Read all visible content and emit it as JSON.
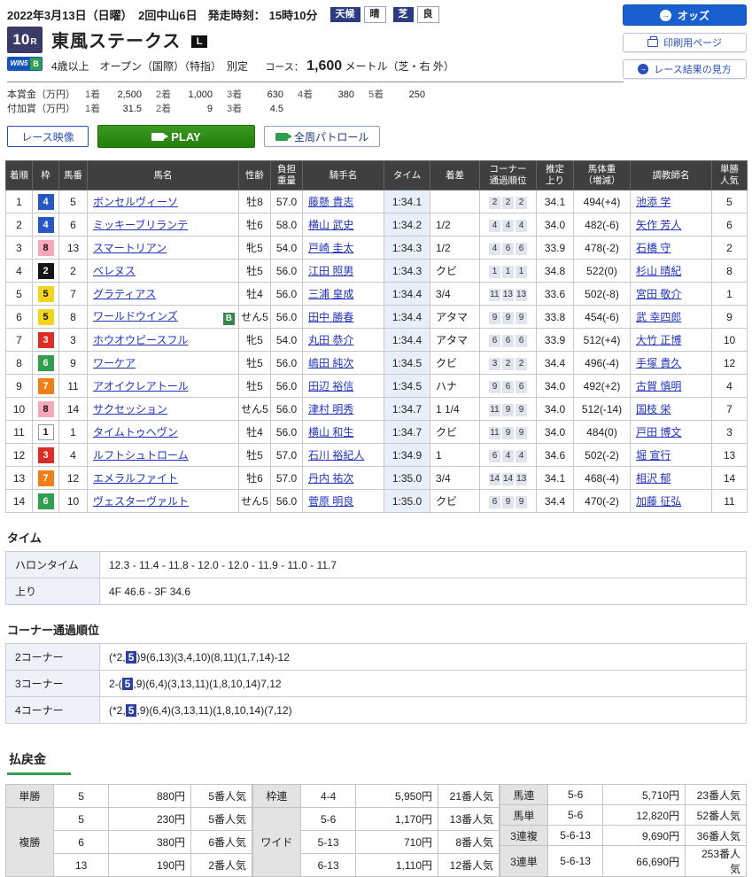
{
  "header": {
    "date_meet": "2022年3月13日（日曜）　2回中山6日",
    "start_label": "発走時刻：",
    "start_time": "15時10分",
    "weather": {
      "label": "天候",
      "value": "晴"
    },
    "turf": {
      "label": "芝",
      "value": "良"
    },
    "buttons": {
      "odds": "オッズ",
      "print": "印刷用ページ",
      "guide": "レース結果の見方"
    }
  },
  "icons": {
    "odds_arrow": "→",
    "guide_arrow": "→"
  },
  "race": {
    "number": "10",
    "r_suffix": "R",
    "win5": "WIN5",
    "win5_b": "B",
    "title": "東風ステークス",
    "grade": "L",
    "conditions": "4歳以上　オープン（国際）（特指）　別定",
    "course_label": "コース：",
    "distance": "1,600",
    "course_detail": "メートル（芝・右 外）",
    "prize_rows": [
      {
        "label": "本賞金（万円）",
        "pairs": [
          [
            "1着",
            "2,500"
          ],
          [
            "2着",
            "1,000"
          ],
          [
            "3着",
            "630"
          ],
          [
            "4着",
            "380"
          ],
          [
            "5着",
            "250"
          ]
        ]
      },
      {
        "label": "付加賞（万円）",
        "pairs": [
          [
            "1着",
            "31.5"
          ],
          [
            "2着",
            "9"
          ],
          [
            "3着",
            "4.5"
          ]
        ]
      }
    ]
  },
  "toolbar": {
    "race_video": "レース映像",
    "play": "PLAY",
    "patrol": "全周パトロール"
  },
  "results": {
    "headers": [
      [
        "着順"
      ],
      [
        "枠"
      ],
      [
        "馬番"
      ],
      [
        "馬名"
      ],
      [
        "性齢"
      ],
      [
        "負担",
        "重量"
      ],
      [
        "騎手名"
      ],
      [
        "タイム"
      ],
      [
        "着差"
      ],
      [
        "コーナー",
        "通過順位"
      ],
      [
        "推定",
        "上り"
      ],
      [
        "馬体重",
        "（増減）"
      ],
      [
        "調教師名"
      ],
      [
        "単勝",
        "人気"
      ]
    ],
    "rows": [
      {
        "pos": "1",
        "waku": "4",
        "wc": "w4",
        "num": "5",
        "horse": "ボンセルヴィーソ",
        "blinker": "",
        "sexage": "牡8",
        "load": "57.0",
        "jockey": "藤懸 貴志",
        "time": "1:34.1",
        "margin": "",
        "corners": [
          "2",
          "2",
          "2"
        ],
        "up": "34.1",
        "bw": "494(+4)",
        "trainer": "池添 学",
        "pop": "5"
      },
      {
        "pos": "2",
        "waku": "4",
        "wc": "w4",
        "num": "6",
        "horse": "ミッキーブリランテ",
        "blinker": "",
        "sexage": "牡6",
        "load": "58.0",
        "jockey": "横山 武史",
        "time": "1:34.2",
        "margin": "1/2",
        "corners": [
          "4",
          "4",
          "4"
        ],
        "up": "34.0",
        "bw": "482(-6)",
        "trainer": "矢作 芳人",
        "pop": "6"
      },
      {
        "pos": "3",
        "waku": "8",
        "wc": "w8",
        "num": "13",
        "horse": "スマートリアン",
        "blinker": "",
        "sexage": "牝5",
        "load": "54.0",
        "jockey": "戸崎 圭太",
        "time": "1:34.3",
        "margin": "1/2",
        "corners": [
          "4",
          "6",
          "6"
        ],
        "up": "33.9",
        "bw": "478(-2)",
        "trainer": "石橋 守",
        "pop": "2"
      },
      {
        "pos": "4",
        "waku": "2",
        "wc": "w2",
        "num": "2",
        "horse": "ベレヌス",
        "blinker": "",
        "sexage": "牡5",
        "load": "56.0",
        "jockey": "江田 照男",
        "time": "1:34.3",
        "margin": "クビ",
        "corners": [
          "1",
          "1",
          "1"
        ],
        "up": "34.8",
        "bw": "522(0)",
        "trainer": "杉山 晴紀",
        "pop": "8"
      },
      {
        "pos": "5",
        "waku": "5",
        "wc": "w5",
        "num": "7",
        "horse": "グラティアス",
        "blinker": "",
        "sexage": "牡4",
        "load": "56.0",
        "jockey": "三浦 皇成",
        "time": "1:34.4",
        "margin": "3/4",
        "corners": [
          "11",
          "13",
          "13"
        ],
        "up": "33.6",
        "bw": "502(-8)",
        "trainer": "宮田 敬介",
        "pop": "1"
      },
      {
        "pos": "6",
        "waku": "5",
        "wc": "w5",
        "num": "8",
        "horse": "ワールドウインズ",
        "blinker": "B",
        "sexage": "せん5",
        "load": "56.0",
        "jockey": "田中 勝春",
        "time": "1:34.4",
        "margin": "アタマ",
        "corners": [
          "9",
          "9",
          "9"
        ],
        "up": "33.8",
        "bw": "454(-6)",
        "trainer": "武 幸四郎",
        "pop": "9"
      },
      {
        "pos": "7",
        "waku": "3",
        "wc": "w3",
        "num": "3",
        "horse": "ホウオウピースフル",
        "blinker": "",
        "sexage": "牝5",
        "load": "54.0",
        "jockey": "丸田 恭介",
        "time": "1:34.4",
        "margin": "アタマ",
        "corners": [
          "6",
          "6",
          "6"
        ],
        "up": "33.9",
        "bw": "512(+4)",
        "trainer": "大竹 正博",
        "pop": "10"
      },
      {
        "pos": "8",
        "waku": "6",
        "wc": "w6",
        "num": "9",
        "horse": "ワーケア",
        "blinker": "",
        "sexage": "牡5",
        "load": "56.0",
        "jockey": "嶋田 純次",
        "time": "1:34.5",
        "margin": "クビ",
        "corners": [
          "3",
          "2",
          "2"
        ],
        "up": "34.4",
        "bw": "496(-4)",
        "trainer": "手塚 貴久",
        "pop": "12"
      },
      {
        "pos": "9",
        "waku": "7",
        "wc": "w7",
        "num": "11",
        "horse": "アオイクレアトール",
        "blinker": "",
        "sexage": "牡5",
        "load": "56.0",
        "jockey": "田辺 裕信",
        "time": "1:34.5",
        "margin": "ハナ",
        "corners": [
          "9",
          "6",
          "6"
        ],
        "up": "34.0",
        "bw": "492(+2)",
        "trainer": "古賀 慎明",
        "pop": "4"
      },
      {
        "pos": "10",
        "waku": "8",
        "wc": "w8",
        "num": "14",
        "horse": "サクセッション",
        "blinker": "",
        "sexage": "せん5",
        "load": "56.0",
        "jockey": "津村 明秀",
        "time": "1:34.7",
        "margin": "1 1/4",
        "corners": [
          "11",
          "9",
          "9"
        ],
        "up": "34.0",
        "bw": "512(-14)",
        "trainer": "国枝 栄",
        "pop": "7"
      },
      {
        "pos": "11",
        "waku": "1",
        "wc": "w1",
        "num": "1",
        "horse": "タイムトゥヘヴン",
        "blinker": "",
        "sexage": "牡4",
        "load": "56.0",
        "jockey": "横山 和生",
        "time": "1:34.7",
        "margin": "クビ",
        "corners": [
          "11",
          "9",
          "9"
        ],
        "up": "34.0",
        "bw": "484(0)",
        "trainer": "戸田 博文",
        "pop": "3"
      },
      {
        "pos": "12",
        "waku": "3",
        "wc": "w3",
        "num": "4",
        "horse": "ルフトシュトローム",
        "blinker": "",
        "sexage": "牡5",
        "load": "57.0",
        "jockey": "石川 裕紀人",
        "time": "1:34.9",
        "margin": "1",
        "corners": [
          "6",
          "4",
          "4"
        ],
        "up": "34.6",
        "bw": "502(-2)",
        "trainer": "堀 宣行",
        "pop": "13"
      },
      {
        "pos": "13",
        "waku": "7",
        "wc": "w7",
        "num": "12",
        "horse": "エメラルファイト",
        "blinker": "",
        "sexage": "牡6",
        "load": "57.0",
        "jockey": "丹内 祐次",
        "time": "1:35.0",
        "margin": "3/4",
        "corners": [
          "14",
          "14",
          "13"
        ],
        "up": "34.1",
        "bw": "468(-4)",
        "trainer": "相沢 郁",
        "pop": "14"
      },
      {
        "pos": "14",
        "waku": "6",
        "wc": "w6",
        "num": "10",
        "horse": "ヴェスターヴァルト",
        "blinker": "",
        "sexage": "せん5",
        "load": "56.0",
        "jockey": "菅原 明良",
        "time": "1:35.0",
        "margin": "クビ",
        "corners": [
          "6",
          "9",
          "9"
        ],
        "up": "34.4",
        "bw": "470(-2)",
        "trainer": "加藤 征弘",
        "pop": "11"
      }
    ]
  },
  "laps": {
    "title": "タイム",
    "rows": [
      {
        "label": "ハロンタイム",
        "value": "12.3 - 11.4 - 11.8 - 12.0 - 12.0 - 11.9 - 11.0 - 11.7"
      },
      {
        "label": "上り",
        "value": "4F 46.6 - 3F 34.6"
      }
    ]
  },
  "corners": {
    "title": "コーナー通過順位",
    "rows": [
      {
        "label": "2コーナー",
        "before": "(*2,",
        "mark": "5",
        "after": ")9(6,13)(3,4,10)(8,11)(1,7,14)-12"
      },
      {
        "label": "3コーナー",
        "before": "2-(",
        "mark": "5",
        "after": ",9)(6,4)(3,13,11)(1,8,10,14)7,12"
      },
      {
        "label": "4コーナー",
        "before": "(*2,",
        "mark": "5",
        "after": ",9)(6,4)(3,13,11)(1,8,10,14)(7,12)"
      }
    ]
  },
  "payouts": {
    "title": "払戻金",
    "groups": [
      {
        "rows": [
          {
            "label": "単勝",
            "span": 1,
            "combo": "5",
            "amount": "880円",
            "pop": "5番人気"
          },
          {
            "label": "複勝",
            "span": 3,
            "combo": "5",
            "amount": "230円",
            "pop": "5番人気"
          },
          {
            "label": "",
            "span": 0,
            "combo": "6",
            "amount": "380円",
            "pop": "6番人気"
          },
          {
            "label": "",
            "span": 0,
            "combo": "13",
            "amount": "190円",
            "pop": "2番人気"
          }
        ]
      },
      {
        "rows": [
          {
            "label": "枠連",
            "span": 1,
            "combo": "4-4",
            "amount": "5,950円",
            "pop": "21番人気"
          },
          {
            "label": "ワイド",
            "span": 3,
            "combo": "5-6",
            "amount": "1,170円",
            "pop": "13番人気"
          },
          {
            "label": "",
            "span": 0,
            "combo": "5-13",
            "amount": "710円",
            "pop": "8番人気"
          },
          {
            "label": "",
            "span": 0,
            "combo": "6-13",
            "amount": "1,110円",
            "pop": "12番人気"
          }
        ]
      },
      {
        "rows": [
          {
            "label": "馬連",
            "span": 1,
            "combo": "5-6",
            "amount": "5,710円",
            "pop": "23番人気"
          },
          {
            "label": "馬単",
            "span": 1,
            "combo": "5-6",
            "amount": "12,820円",
            "pop": "52番人気"
          },
          {
            "label": "3連複",
            "span": 1,
            "combo": "5-6-13",
            "amount": "9,690円",
            "pop": "36番人気"
          },
          {
            "label": "3連単",
            "span": 1,
            "combo": "5-6-13",
            "amount": "66,690円",
            "pop": "253番人気"
          }
        ]
      }
    ]
  },
  "colors": {
    "accent_blue": "#1a5fd0",
    "header_dark": "#3f3f3f",
    "mark_navy": "#2d3f9e",
    "green": "#2f9e4e"
  }
}
